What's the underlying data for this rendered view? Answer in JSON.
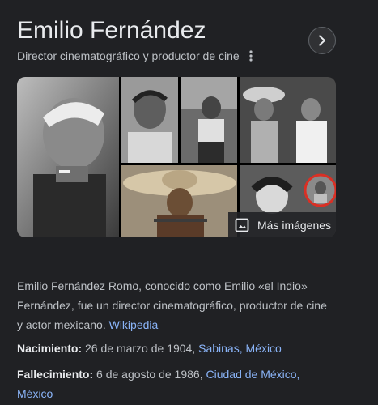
{
  "header": {
    "title": "Emilio Fernández",
    "subtitle": "Director cinematográfico y productor de cine"
  },
  "gallery": {
    "more_images_label": "Más imágenes"
  },
  "description": {
    "text": "Emilio Fernández Romo, conocido como Emilio «el Indio» Fernández, fue un director cinematográfico, productor de cine y actor mexicano.",
    "source_link": "Wikipedia"
  },
  "facts": {
    "birth": {
      "label": "Nacimiento:",
      "date": "26 de marzo de 1904,",
      "place_link": "Sabinas, México"
    },
    "death": {
      "label": "Fallecimiento:",
      "date": "6 de agosto de 1986,",
      "place_link_1": "Ciudad de México,",
      "place_link_2": "México"
    }
  },
  "icons": {
    "more": "kebab-icon",
    "next": "chevron-right-icon",
    "images": "image-icon"
  }
}
